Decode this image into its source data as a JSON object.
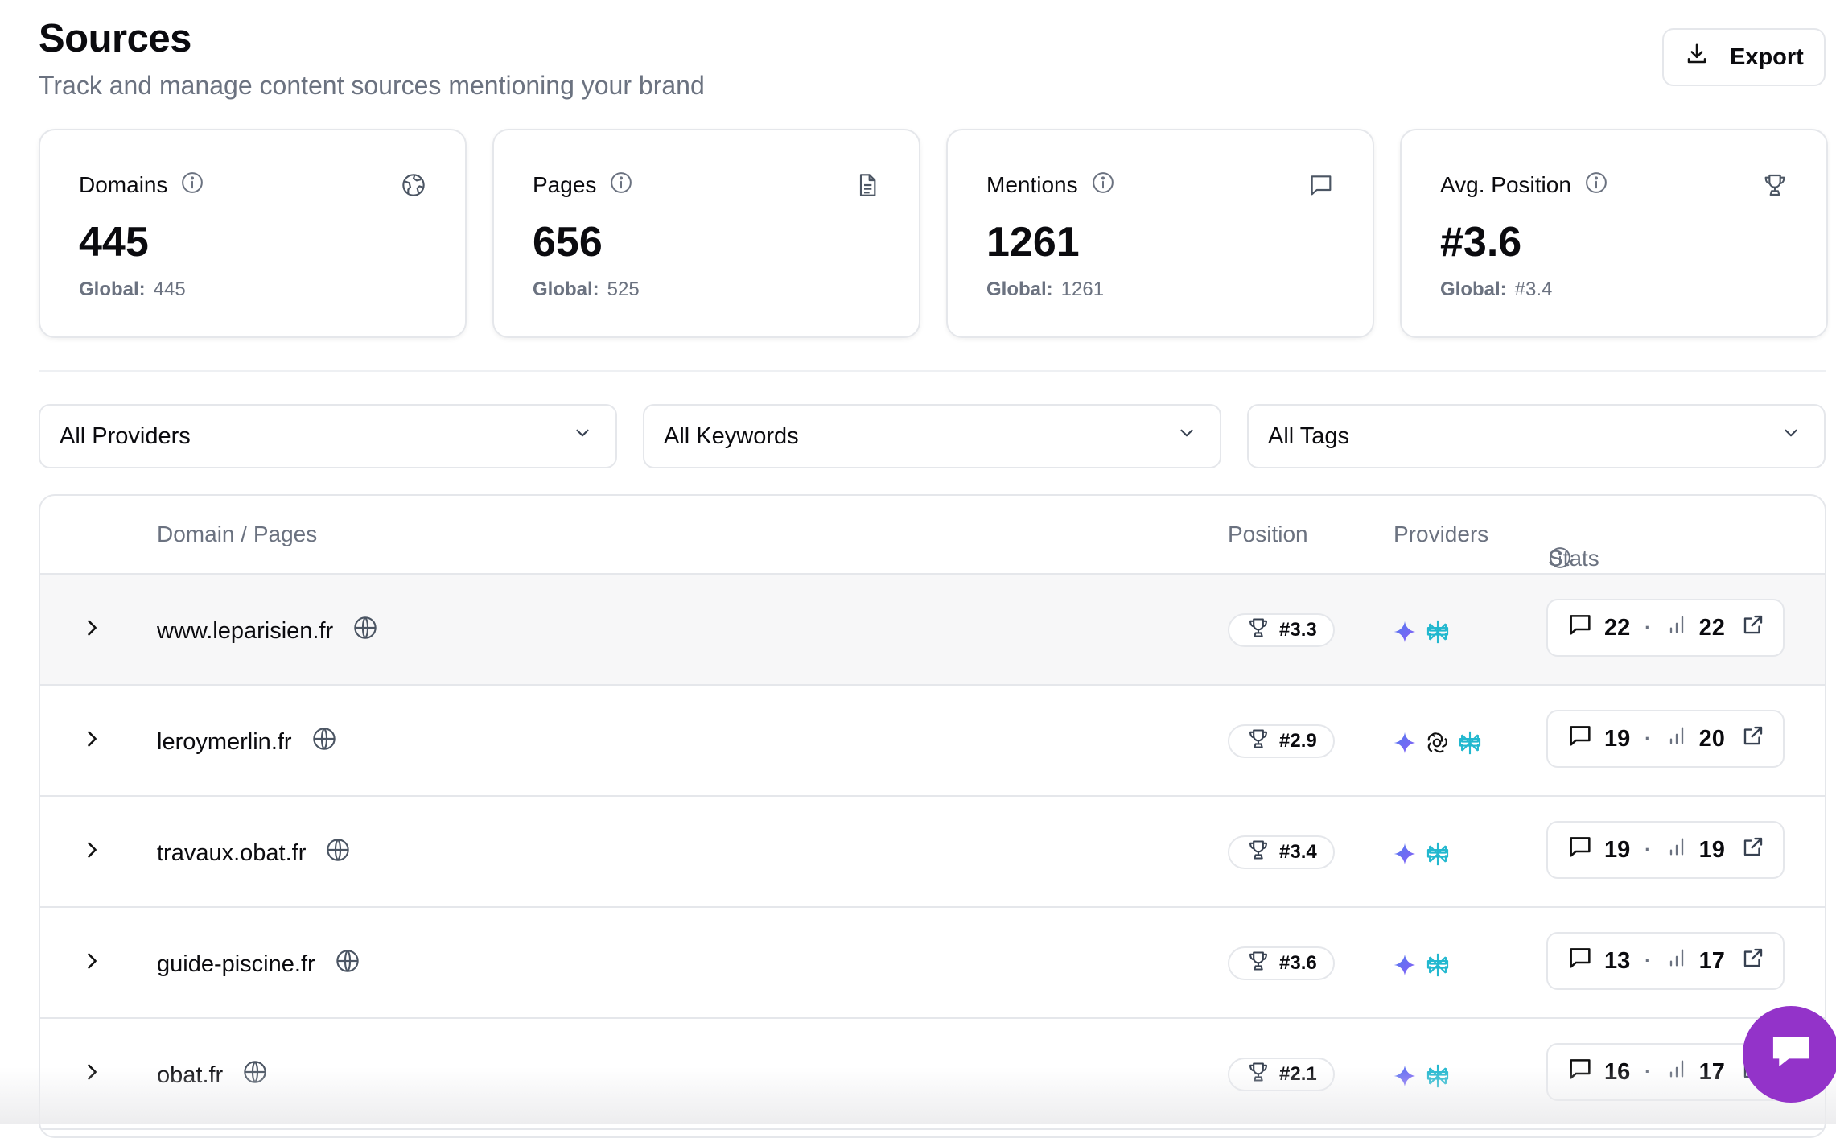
{
  "header": {
    "title": "Sources",
    "subtitle": "Track and manage content sources mentioning your brand",
    "export_label": "Export"
  },
  "cards": [
    {
      "label": "Domains",
      "value": "445",
      "global_label": "Global:",
      "global_value": "445",
      "icon": "globe-outline-icon"
    },
    {
      "label": "Pages",
      "value": "656",
      "global_label": "Global:",
      "global_value": "525",
      "icon": "document-icon"
    },
    {
      "label": "Mentions",
      "value": "1261",
      "global_label": "Global:",
      "global_value": "1261",
      "icon": "message-square-icon"
    },
    {
      "label": "Avg. Position",
      "value": "#3.6",
      "global_label": "Global:",
      "global_value": "#3.4",
      "icon": "trophy-icon"
    }
  ],
  "filters": [
    {
      "label": "All Providers"
    },
    {
      "label": "All Keywords"
    },
    {
      "label": "All Tags"
    }
  ],
  "table": {
    "columns": {
      "domain": "Domain / Pages",
      "position": "Position",
      "providers": "Providers",
      "stats": "Stats"
    },
    "rows": [
      {
        "domain": "www.leparisien.fr",
        "position": "#3.3",
        "providers": [
          "gemini",
          "perplexity"
        ],
        "mentions": "22",
        "views": "22"
      },
      {
        "domain": "leroymerlin.fr",
        "position": "#2.9",
        "providers": [
          "gemini",
          "openai",
          "perplexity"
        ],
        "mentions": "19",
        "views": "20"
      },
      {
        "domain": "travaux.obat.fr",
        "position": "#3.4",
        "providers": [
          "gemini",
          "perplexity"
        ],
        "mentions": "19",
        "views": "19"
      },
      {
        "domain": "guide-piscine.fr",
        "position": "#3.6",
        "providers": [
          "gemini",
          "perplexity"
        ],
        "mentions": "13",
        "views": "17"
      },
      {
        "domain": "obat.fr",
        "position": "#2.1",
        "providers": [
          "gemini",
          "perplexity"
        ],
        "mentions": "16",
        "views": "17"
      }
    ]
  },
  "colors": {
    "accent_purple": "#9333c9",
    "gemini_blue": "#4f7cf0",
    "perplexity_teal": "#22b8cf",
    "border": "#e5e7eb",
    "muted_text": "#6b7280"
  }
}
